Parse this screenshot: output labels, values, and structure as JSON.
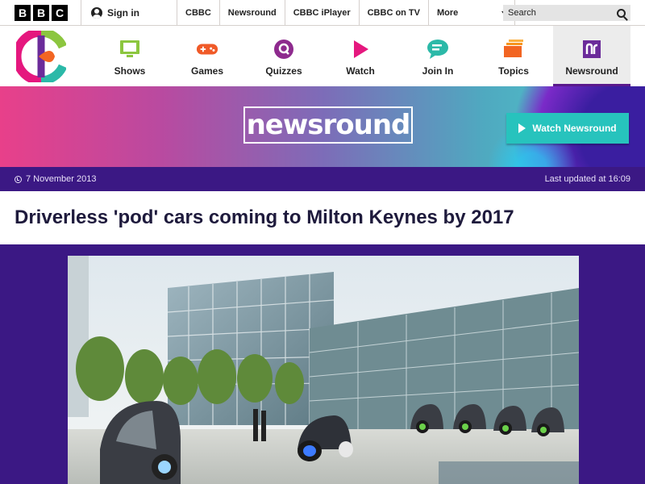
{
  "bbc_bar": {
    "logo_letters": [
      "B",
      "B",
      "C"
    ],
    "signin_label": "Sign in",
    "links": [
      "CBBC",
      "Newsround",
      "CBBC iPlayer",
      "CBBC on TV"
    ],
    "more_label": "More",
    "search_placeholder": "Search"
  },
  "cbbc_nav": {
    "items": [
      {
        "label": "Shows",
        "icon": "tv-icon",
        "color": "#8cc63f"
      },
      {
        "label": "Games",
        "icon": "gamepad-icon",
        "color": "#f05a28"
      },
      {
        "label": "Quizzes",
        "icon": "quiz-icon",
        "color": "#8e2a8e"
      },
      {
        "label": "Watch",
        "icon": "play-icon",
        "color": "#e5177e"
      },
      {
        "label": "Join In",
        "icon": "chat-icon",
        "color": "#2bb9a8"
      },
      {
        "label": "Topics",
        "icon": "folders-icon",
        "color": "#f26522"
      },
      {
        "label": "Newsround",
        "icon": "newsround-icon",
        "color": "#6b2b9a"
      }
    ],
    "active": "Newsround"
  },
  "banner": {
    "logo_text": "newsround",
    "watch_button": "Watch Newsround"
  },
  "meta": {
    "date": "7 November 2013",
    "last_updated": "Last updated at 16:09"
  },
  "article": {
    "headline": "Driverless 'pod' cars coming to Milton Keynes by 2017"
  },
  "colors": {
    "purple": "#3b1884",
    "teal": "#27c3bd",
    "banner_pink": "#e8408a"
  }
}
